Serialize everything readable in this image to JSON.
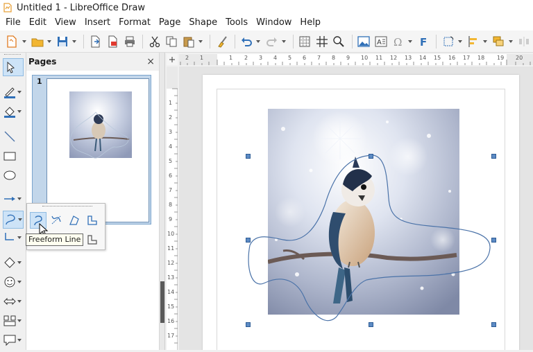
{
  "window": {
    "title": "Untitled 1 - LibreOffice Draw"
  },
  "menu": [
    "File",
    "Edit",
    "View",
    "Insert",
    "Format",
    "Page",
    "Shape",
    "Tools",
    "Window",
    "Help"
  ],
  "pages_panel": {
    "title": "Pages",
    "close_glyph": "×",
    "page_number": "1"
  },
  "flyout": {
    "tooltip": "Freeform Line"
  },
  "hruler_labels": [
    "2",
    "1",
    "1",
    "2",
    "3",
    "4",
    "5",
    "6",
    "7",
    "8",
    "9",
    "10",
    "11",
    "12",
    "13",
    "14",
    "15",
    "16",
    "17",
    "18",
    "19",
    "20"
  ],
  "vruler_labels": [
    "1",
    "2",
    "3",
    "4",
    "5",
    "6",
    "7",
    "8",
    "9",
    "10",
    "11",
    "12",
    "13",
    "14",
    "15",
    "16",
    "17"
  ],
  "colors": {
    "selection_handle": "#5d8bc4",
    "freeform_stroke": "#4a72a8",
    "selected_tool": "#cde3f7"
  }
}
